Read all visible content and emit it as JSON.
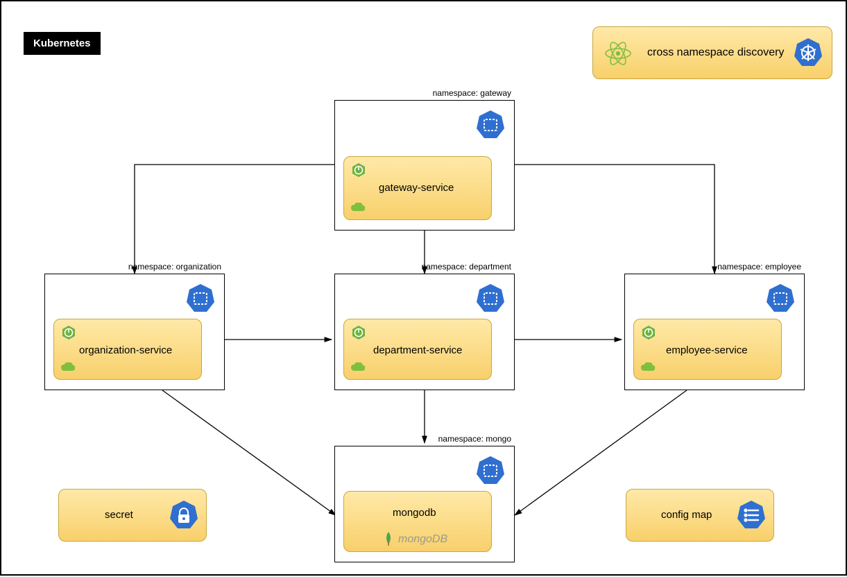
{
  "header": {
    "kubernetes_label": "Kubernetes"
  },
  "banner": {
    "title": "cross namespace discovery"
  },
  "namespaces": {
    "gateway": {
      "label": "namespace: gateway",
      "service": "gateway-service"
    },
    "organization": {
      "label": "namespace: organization",
      "service": "organization-service"
    },
    "department": {
      "label": "namespace:  department",
      "service": "department-service"
    },
    "employee": {
      "label": "namespace: employee",
      "service": "employee-service"
    },
    "mongo": {
      "label": "namespace: mongo",
      "service": "mongodb",
      "logo": "mongoDB"
    }
  },
  "aux": {
    "secret": "secret",
    "configmap": "config map"
  },
  "arrows": [
    {
      "from": "gateway",
      "to": "organization"
    },
    {
      "from": "gateway",
      "to": "department"
    },
    {
      "from": "gateway",
      "to": "employee"
    },
    {
      "from": "organization",
      "to": "department"
    },
    {
      "from": "department",
      "to": "employee"
    },
    {
      "from": "organization",
      "to": "mongo"
    },
    {
      "from": "department",
      "to": "mongo"
    },
    {
      "from": "employee",
      "to": "mongo"
    }
  ]
}
